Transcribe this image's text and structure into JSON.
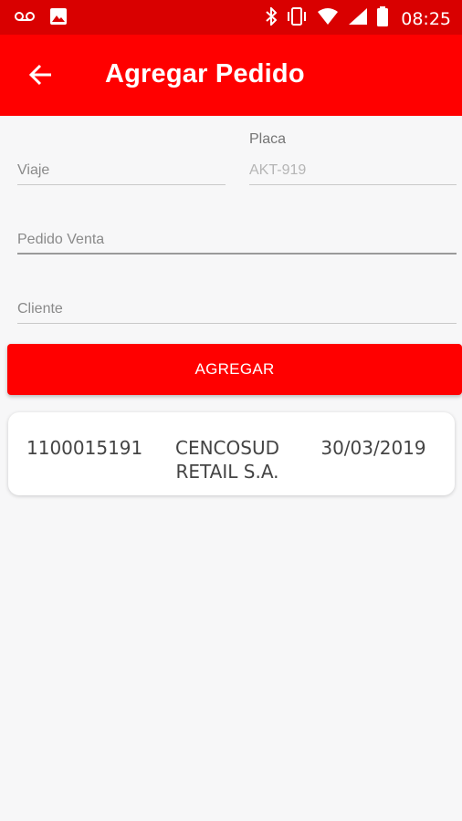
{
  "status_bar": {
    "time": "08:25",
    "icons": [
      "voicemail-icon",
      "image-icon",
      "bluetooth-icon",
      "vibrate-icon",
      "wifi-icon",
      "signal-icon",
      "battery-icon"
    ]
  },
  "app_bar": {
    "title": "Agregar Pedido",
    "back_icon": "arrow-left-icon"
  },
  "form": {
    "viaje": {
      "placeholder": "Viaje"
    },
    "placa": {
      "label": "Placa",
      "placeholder": "AKT-919"
    },
    "pedido_venta": {
      "placeholder": "Pedido Venta"
    },
    "cliente": {
      "placeholder": "Cliente"
    },
    "add_button_label": "AGREGAR"
  },
  "orders": [
    {
      "id": "1100015191",
      "client": "CENCOSUD RETAIL S.A.",
      "date": "30/03/2019"
    }
  ],
  "colors": {
    "primary": "#ff0000",
    "status_bar": "#d90000",
    "background": "#f7f7f8"
  }
}
